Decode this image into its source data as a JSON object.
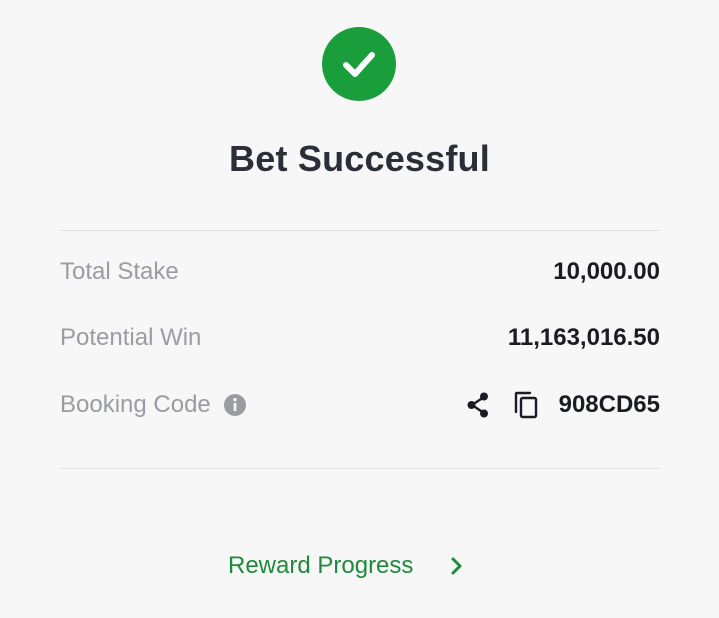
{
  "status": {
    "title": "Bet Successful",
    "success_color": "#1a9e3c",
    "icon": "checkmark-icon"
  },
  "summary": {
    "total_stake_label": "Total Stake",
    "total_stake_value": "10,000.00",
    "potential_win_label": "Potential Win",
    "potential_win_value": "11,163,016.50",
    "booking_code_label": "Booking Code",
    "booking_code_value": "908CD65"
  },
  "icons": {
    "info": "info-icon",
    "share": "share-icon",
    "copy": "copy-icon",
    "chevron": "chevron-right-icon"
  },
  "footer": {
    "reward_progress_label": "Reward Progress",
    "accent_color": "#1e8a3a"
  }
}
